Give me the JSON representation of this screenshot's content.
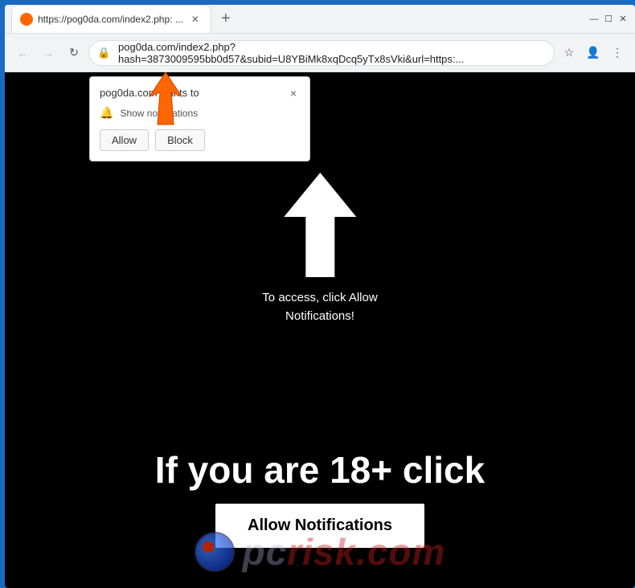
{
  "browser": {
    "tab": {
      "title": "https://pog0da.com/index2.php: ...",
      "favicon_alt": "site-favicon"
    },
    "address_bar": {
      "url": "pog0da.com/index2.php?hash=3873009595bb0d57&subid=U8YBiMk8xqDcq5yTx8sVki&url=https:...",
      "lock_icon": "🔒"
    },
    "controls": {
      "minimize": "—",
      "maximize": "☐",
      "close": "✕",
      "back": "←",
      "forward": "→",
      "refresh": "↻",
      "new_tab": "+"
    }
  },
  "notification_popup": {
    "title": "pog0da.com wants to",
    "notification_text": "Show notifications",
    "allow_label": "Allow",
    "block_label": "Block",
    "close_symbol": "×"
  },
  "page": {
    "instruction_text": "To access, click Allow\nNotifications!",
    "big_text": "If you are 18+ click",
    "allow_button_label": "Allow Notifications",
    "pcrisk_text": "risk.com"
  },
  "colors": {
    "browser_border": "#1a6bbf",
    "page_bg": "#000000",
    "popup_bg": "#ffffff",
    "allow_btn_bg": "#ffffff",
    "orange_arrow": "#ff6600"
  }
}
